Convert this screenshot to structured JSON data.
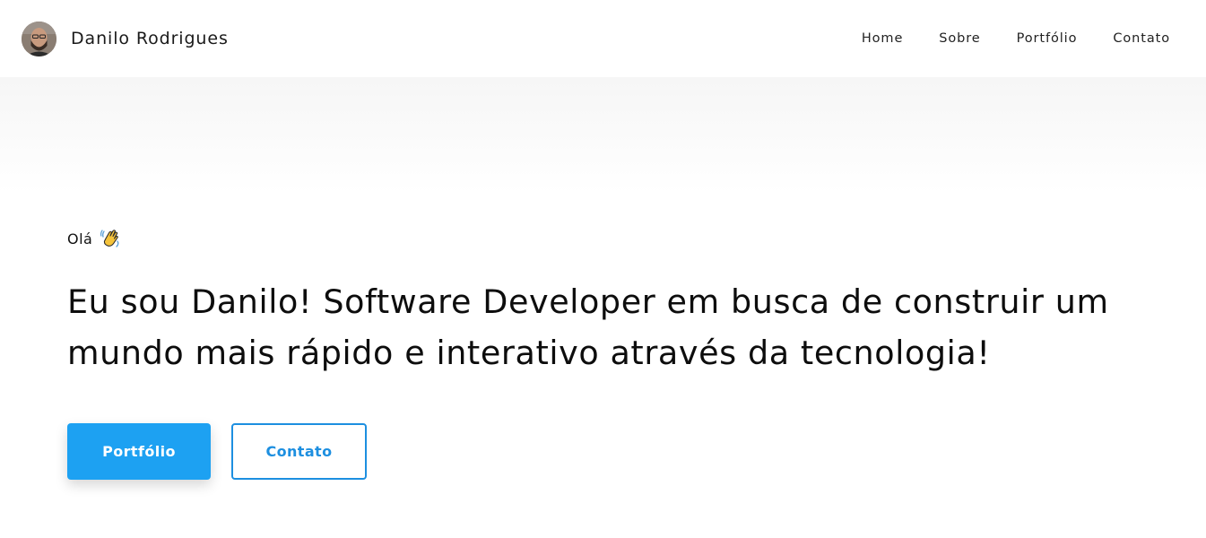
{
  "header": {
    "brand_name": "Danilo Rodrigues",
    "nav": [
      {
        "label": "Home"
      },
      {
        "label": "Sobre"
      },
      {
        "label": "Portfólio"
      },
      {
        "label": "Contato"
      }
    ]
  },
  "hero": {
    "greeting": "Olá",
    "greeting_icon": "waving-hand-icon",
    "headline": "Eu sou Danilo! Software Developer em busca de construir um mundo mais rápido e interativo através da tecnologia!",
    "primary_button": "Portfólio",
    "secondary_button": "Contato"
  },
  "colors": {
    "accent": "#1da1f2",
    "outline": "#1d8fe0",
    "text": "#111111"
  }
}
